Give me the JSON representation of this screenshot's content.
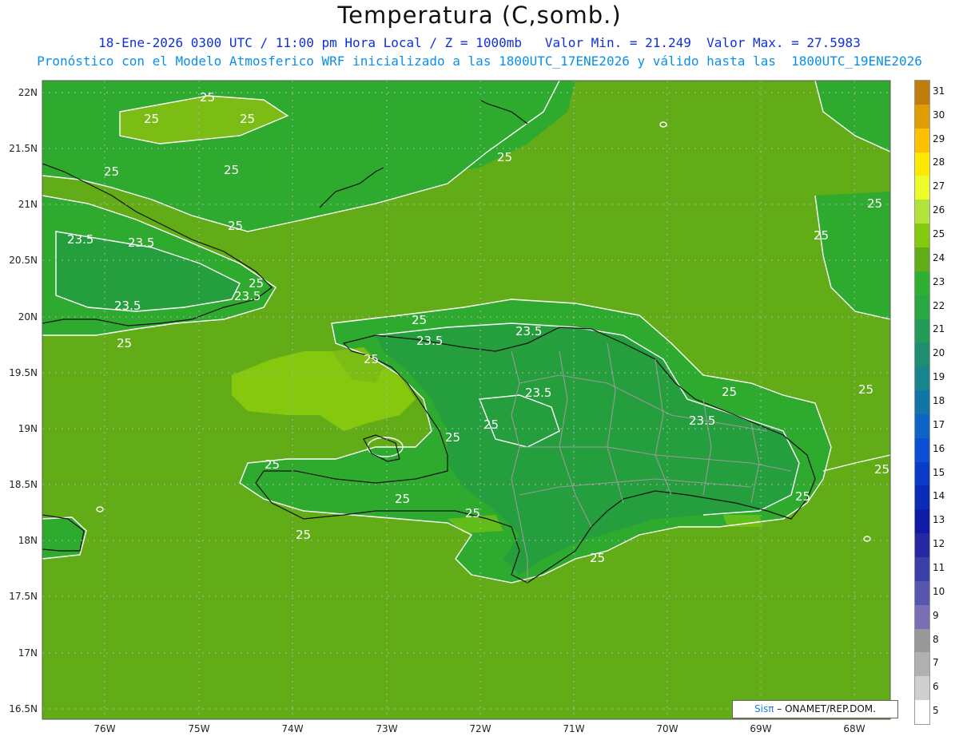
{
  "header": {
    "title": "Temperatura (C,somb.)",
    "line1": "18-Ene-2026 0300 UTC / 11:00 pm Hora Local / Z = 1000mb   Valor Min. = 21.249  Valor Max. = 27.5983",
    "line2": "Pronóstico con el Modelo Atmosferico WRF inicializado a las 1800UTC_17ENE2026 y válido hasta las  1800UTC_19ENE2026"
  },
  "map": {
    "lat_labels": [
      "22N",
      "21.5N",
      "21N",
      "20.5N",
      "20N",
      "19.5N",
      "19N",
      "18.5N",
      "18N",
      "17.5N",
      "17N",
      "16.5N"
    ],
    "lon_labels": [
      "76W",
      "75W",
      "74W",
      "73W",
      "72W",
      "71W",
      "70W",
      "69W",
      "68W"
    ],
    "contour_labels": [
      "25",
      "25",
      "25",
      "25",
      "25",
      "25",
      "25",
      "23.5",
      "23.5",
      "23.5",
      "25",
      "23.5",
      "25",
      "25",
      "23.5",
      "25",
      "23.5",
      "25",
      "25",
      "23.5",
      "25",
      "23.5",
      "25",
      "25",
      "25",
      "25",
      "25",
      "25",
      "25",
      "25",
      "25",
      "25"
    ],
    "colors": {
      "sea": "#62ad17",
      "land_warm": "#2eaa2e",
      "land_cool": "#259e3d",
      "warm_patch": "#86c80e",
      "coast": "#111111",
      "border": "#999999",
      "contour": "#ffffff"
    }
  },
  "colorbar": {
    "levels": [
      "31",
      "30",
      "29",
      "28",
      "27",
      "26",
      "25",
      "24",
      "23",
      "22",
      "21",
      "20",
      "19",
      "18",
      "17",
      "16",
      "15",
      "14",
      "13",
      "12",
      "11",
      "10",
      "9",
      "8",
      "7",
      "6",
      "5"
    ],
    "colors": [
      "#c17d0b",
      "#e09c05",
      "#fbc000",
      "#fbe900",
      "#eefb2b",
      "#b2e33a",
      "#85c90e",
      "#62ad17",
      "#30b030",
      "#27a840",
      "#239a55",
      "#1f8e70",
      "#18858c",
      "#1275a8",
      "#0e64c4",
      "#0a4fd4",
      "#0a3cc8",
      "#0a2ab8",
      "#0f1aa5",
      "#2528a0",
      "#3b3fa8",
      "#5757b0",
      "#7a6fb5",
      "#999999",
      "#b0b0b0",
      "#cfcfcf",
      "#ffffff"
    ]
  },
  "credit": {
    "sis": "Sisπ",
    "rest": " – ONAMET/REP.DOM."
  }
}
